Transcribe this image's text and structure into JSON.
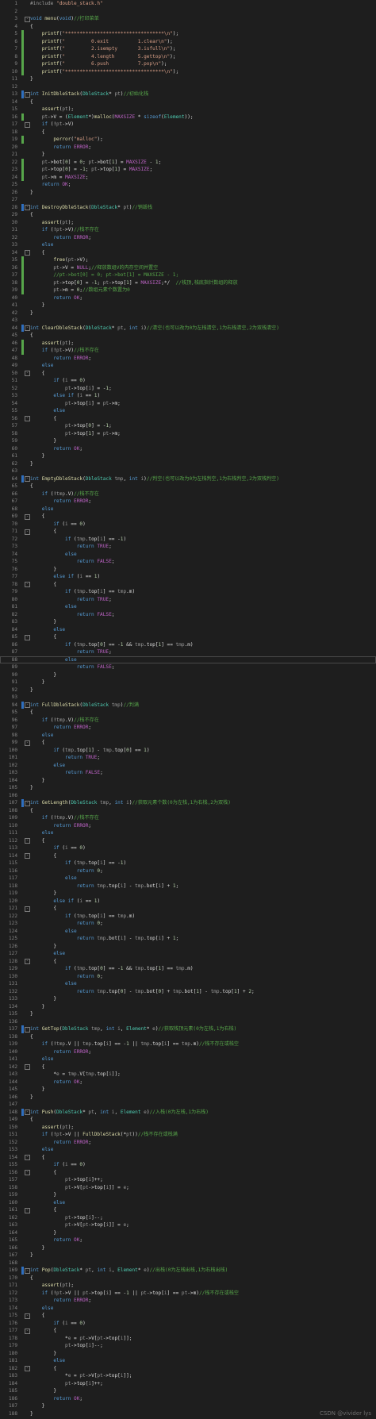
{
  "watermark": "CSDN @vivider lys",
  "colors": {
    "background": "#1e1e1e",
    "keyword": "#569cd6",
    "type": "#4ec9b0",
    "function": "#dcdcaa",
    "string": "#d69d85",
    "comment": "#57a64a",
    "macro": "#bd63c5",
    "number": "#b5cea8",
    "param": "#9a9a9a",
    "text": "#dcdcdc",
    "line_number": "#858585"
  },
  "lines": [
    {
      "n": "1",
      "t": "#include \"double_stack.h\""
    },
    {
      "n": "2",
      "t": ""
    },
    {
      "n": "3",
      "t": "void menu(void)//打印菜单"
    },
    {
      "n": "4",
      "t": "{"
    },
    {
      "n": "5",
      "t": "    printf(\"**********************************\\n\");"
    },
    {
      "n": "6",
      "t": "    printf(\"         0.exit          1.clear\\n\");"
    },
    {
      "n": "7",
      "t": "    printf(\"         2.isempty       3.isfull\\n\");"
    },
    {
      "n": "8",
      "t": "    printf(\"         4.length        5.gettop\\n\");"
    },
    {
      "n": "9",
      "t": "    printf(\"         6.push          7.pop\\n\");"
    },
    {
      "n": "10",
      "t": "    printf(\"**********************************\\n\");"
    },
    {
      "n": "11",
      "t": "}"
    },
    {
      "n": "12",
      "t": ""
    },
    {
      "n": "13",
      "t": "int InitDbleStack(DbleStack* pt)//初始化栈"
    },
    {
      "n": "14",
      "t": "{"
    },
    {
      "n": "15",
      "t": "    assert(pt);"
    },
    {
      "n": "16",
      "t": "    pt->V = (Element*)malloc(MAXSIZE * sizeof(Element));"
    },
    {
      "n": "17",
      "t": "    if (!pt->V)"
    },
    {
      "n": "18",
      "t": "    {"
    },
    {
      "n": "19",
      "t": "        perror(\"malloc\");"
    },
    {
      "n": "20",
      "t": "        return ERROR;"
    },
    {
      "n": "21",
      "t": "    }"
    },
    {
      "n": "22",
      "t": "    pt->bot[0] = 0; pt->bot[1] = MAXSIZE - 1;"
    },
    {
      "n": "23",
      "t": "    pt->top[0] = -1; pt->top[1] = MAXSIZE;"
    },
    {
      "n": "24",
      "t": "    pt->m = MAXSIZE;"
    },
    {
      "n": "25",
      "t": "    return OK;"
    },
    {
      "n": "26",
      "t": "}"
    },
    {
      "n": "27",
      "t": ""
    },
    {
      "n": "28",
      "t": "int DestroyDbleStack(DbleStack* pt)//销毁栈"
    },
    {
      "n": "29",
      "t": "{"
    },
    {
      "n": "30",
      "t": "    assert(pt);"
    },
    {
      "n": "31",
      "t": "    if (!pt->V)//栈不存在"
    },
    {
      "n": "32",
      "t": "        return ERROR;"
    },
    {
      "n": "33",
      "t": "    else"
    },
    {
      "n": "34",
      "t": "    {"
    },
    {
      "n": "35",
      "t": "        free(pt->V);"
    },
    {
      "n": "36",
      "t": "        pt->V = NULL;//释放数组V的内存空间并置空"
    },
    {
      "n": "37",
      "t": "        //pt->bot[0] = 0; pt->bot[1] = MAXSIZE - 1;"
    },
    {
      "n": "38",
      "t": "        pt->top[0] = -1; pt->top[1] = MAXSIZE;*/  //栈顶,栈底指针数组的释放"
    },
    {
      "n": "39",
      "t": "        pt->m = 0;//数组元素个数置为0"
    },
    {
      "n": "40",
      "t": "        return OK;"
    },
    {
      "n": "41",
      "t": "    }"
    },
    {
      "n": "42",
      "t": "}"
    },
    {
      "n": "43",
      "t": ""
    },
    {
      "n": "44",
      "t": "int ClearDbleStack(DbleStack* pt, int i)//清空(也可以改为0为左栈清空,1为右栈清空,2为双栈清空)"
    },
    {
      "n": "45",
      "t": "{"
    },
    {
      "n": "46",
      "t": "    assert(pt);"
    },
    {
      "n": "47",
      "t": "    if (!pt->V)//栈不存在"
    },
    {
      "n": "48",
      "t": "        return ERROR;"
    },
    {
      "n": "49",
      "t": "    else"
    },
    {
      "n": "50",
      "t": "    {"
    },
    {
      "n": "51",
      "t": "        if (i == 0)"
    },
    {
      "n": "52",
      "t": "            pt->top[i] = -1;"
    },
    {
      "n": "53",
      "t": "        else if (i == 1)"
    },
    {
      "n": "54",
      "t": "            pt->top[i] = pt->m;"
    },
    {
      "n": "55",
      "t": "        else"
    },
    {
      "n": "56",
      "t": "        {"
    },
    {
      "n": "57",
      "t": "            pt->top[0] = -1;"
    },
    {
      "n": "58",
      "t": "            pt->top[1] = pt->m;"
    },
    {
      "n": "59",
      "t": "        }"
    },
    {
      "n": "60",
      "t": "        return OK;"
    },
    {
      "n": "61",
      "t": "    }"
    },
    {
      "n": "62",
      "t": "}"
    },
    {
      "n": "63",
      "t": ""
    },
    {
      "n": "64",
      "t": "int EmptyDbleStack(DbleStack tmp, int i)//判空(也可以改为0为左栈判空,1为右栈判空,2为双栈判空)"
    },
    {
      "n": "65",
      "t": "{"
    },
    {
      "n": "66",
      "t": "    if (!tmp.V)//栈不存在"
    },
    {
      "n": "67",
      "t": "        return ERROR;"
    },
    {
      "n": "68",
      "t": "    else"
    },
    {
      "n": "69",
      "t": "    {"
    },
    {
      "n": "70",
      "t": "        if (i == 0)"
    },
    {
      "n": "71",
      "t": "        {"
    },
    {
      "n": "72",
      "t": "            if (tmp.top[i] == -1)"
    },
    {
      "n": "73",
      "t": "                return TRUE;"
    },
    {
      "n": "74",
      "t": "            else"
    },
    {
      "n": "75",
      "t": "                return FALSE;"
    },
    {
      "n": "76",
      "t": "        }"
    },
    {
      "n": "77",
      "t": "        else if (i == 1)"
    },
    {
      "n": "78",
      "t": "        {"
    },
    {
      "n": "79",
      "t": "            if (tmp.top[i] == tmp.m)"
    },
    {
      "n": "80",
      "t": "                return TRUE;"
    },
    {
      "n": "81",
      "t": "            else"
    },
    {
      "n": "82",
      "t": "                return FALSE;"
    },
    {
      "n": "83",
      "t": "        }"
    },
    {
      "n": "84",
      "t": "        else"
    },
    {
      "n": "85",
      "t": "        {"
    },
    {
      "n": "86",
      "t": "            if (tmp.top[0] == -1 && tmp.top[1] == tmp.m)"
    },
    {
      "n": "87",
      "t": "                return TRUE;"
    },
    {
      "n": "88",
      "t": "            else"
    },
    {
      "n": "89",
      "t": "                return FALSE;"
    },
    {
      "n": "90",
      "t": "        }"
    },
    {
      "n": "91",
      "t": "    }"
    },
    {
      "n": "92",
      "t": "}"
    },
    {
      "n": "93",
      "t": ""
    },
    {
      "n": "94",
      "t": "int FullDbleStack(DbleStack tmp)//判满"
    },
    {
      "n": "95",
      "t": "{"
    },
    {
      "n": "96",
      "t": "    if (!tmp.V)//栈不存在"
    },
    {
      "n": "97",
      "t": "        return ERROR;"
    },
    {
      "n": "98",
      "t": "    else"
    },
    {
      "n": "99",
      "t": "    {"
    },
    {
      "n": "100",
      "t": "        if (tmp.top[1] - tmp.top[0] == 1)"
    },
    {
      "n": "101",
      "t": "            return TRUE;"
    },
    {
      "n": "102",
      "t": "        else"
    },
    {
      "n": "103",
      "t": "            return FALSE;"
    },
    {
      "n": "104",
      "t": "    }"
    },
    {
      "n": "105",
      "t": "}"
    },
    {
      "n": "106",
      "t": ""
    },
    {
      "n": "107",
      "t": "int GetLength(DbleStack tmp, int i)//获取元素个数(0为左栈,1为右栈,2为双栈)"
    },
    {
      "n": "108",
      "t": "{"
    },
    {
      "n": "109",
      "t": "    if (!tmp.V)//栈不存在"
    },
    {
      "n": "110",
      "t": "        return ERROR;"
    },
    {
      "n": "111",
      "t": "    else"
    },
    {
      "n": "112",
      "t": "    {"
    },
    {
      "n": "113",
      "t": "        if (i == 0)"
    },
    {
      "n": "114",
      "t": "        {"
    },
    {
      "n": "115",
      "t": "            if (tmp.top[i] == -1)"
    },
    {
      "n": "116",
      "t": "                return 0;"
    },
    {
      "n": "117",
      "t": "            else"
    },
    {
      "n": "118",
      "t": "                return tmp.top[i] - tmp.bot[i] + 1;"
    },
    {
      "n": "119",
      "t": "        }"
    },
    {
      "n": "120",
      "t": "        else if (i == 1)"
    },
    {
      "n": "121",
      "t": "        {"
    },
    {
      "n": "122",
      "t": "            if (tmp.top[i] == tmp.m)"
    },
    {
      "n": "123",
      "t": "                return 0;"
    },
    {
      "n": "124",
      "t": "            else"
    },
    {
      "n": "125",
      "t": "                return tmp.bot[i] - tmp.top[i] + 1;"
    },
    {
      "n": "126",
      "t": "        }"
    },
    {
      "n": "127",
      "t": "        else"
    },
    {
      "n": "128",
      "t": "        {"
    },
    {
      "n": "129",
      "t": "            if (tmp.top[0] == -1 && tmp.top[1] == tmp.m)"
    },
    {
      "n": "130",
      "t": "                return 0;"
    },
    {
      "n": "131",
      "t": "            else"
    },
    {
      "n": "132",
      "t": "                return tmp.top[0] - tmp.bot[0] + tmp.bot[1] - tmp.top[1] + 2;"
    },
    {
      "n": "133",
      "t": "        }"
    },
    {
      "n": "134",
      "t": "    }"
    },
    {
      "n": "135",
      "t": "}"
    },
    {
      "n": "136",
      "t": ""
    },
    {
      "n": "137",
      "t": "int GetTop(DbleStack tmp, int i, Element* e)//获取栈顶元素(0为左栈,1为右栈)"
    },
    {
      "n": "138",
      "t": "{"
    },
    {
      "n": "139",
      "t": "    if (!tmp.V || tmp.top[i] == -1 || tmp.top[i] == tmp.m)//栈不存在或栈空"
    },
    {
      "n": "140",
      "t": "        return ERROR;"
    },
    {
      "n": "141",
      "t": "    else"
    },
    {
      "n": "142",
      "t": "    {"
    },
    {
      "n": "143",
      "t": "        *e = tmp.V[tmp.top[i]];"
    },
    {
      "n": "144",
      "t": "        return OK;"
    },
    {
      "n": "145",
      "t": "    }"
    },
    {
      "n": "146",
      "t": "}"
    },
    {
      "n": "147",
      "t": ""
    },
    {
      "n": "148",
      "t": "int Push(DbleStack* pt, int i, Element e)//入栈(0为左栈,1为右栈)"
    },
    {
      "n": "149",
      "t": "{"
    },
    {
      "n": "150",
      "t": "    assert(pt);"
    },
    {
      "n": "151",
      "t": "    if (!pt->V || FullDbleStack(*pt))//栈不存在或栈满"
    },
    {
      "n": "152",
      "t": "        return ERROR;"
    },
    {
      "n": "153",
      "t": "    else"
    },
    {
      "n": "154",
      "t": "    {"
    },
    {
      "n": "155",
      "t": "        if (i == 0)"
    },
    {
      "n": "156",
      "t": "        {"
    },
    {
      "n": "157",
      "t": "            pt->top[i]++;"
    },
    {
      "n": "158",
      "t": "            pt->V[pt->top[i]] = e;"
    },
    {
      "n": "159",
      "t": "        }"
    },
    {
      "n": "160",
      "t": "        else"
    },
    {
      "n": "161",
      "t": "        {"
    },
    {
      "n": "162",
      "t": "            pt->top[i]--;"
    },
    {
      "n": "163",
      "t": "            pt->V[pt->top[i]] = e;"
    },
    {
      "n": "164",
      "t": "        }"
    },
    {
      "n": "165",
      "t": "        return OK;"
    },
    {
      "n": "166",
      "t": "    }"
    },
    {
      "n": "167",
      "t": "}"
    },
    {
      "n": "168",
      "t": ""
    },
    {
      "n": "169",
      "t": "int Pop(DbleStack* pt, int i, Element* e)//出栈(0为左栈出栈,1为右栈出栈)"
    },
    {
      "n": "170",
      "t": "{"
    },
    {
      "n": "171",
      "t": "    assert(pt);"
    },
    {
      "n": "172",
      "t": "    if (!pt->V || pt->top[i] == -1 || pt->top[i] == pt->m)//栈不存在或栈空"
    },
    {
      "n": "173",
      "t": "        return ERROR;"
    },
    {
      "n": "174",
      "t": "    else"
    },
    {
      "n": "175",
      "t": "    {"
    },
    {
      "n": "176",
      "t": "        if (i == 0)"
    },
    {
      "n": "177",
      "t": "        {"
    },
    {
      "n": "178",
      "t": "            *e = pt->V[pt->top[i]];"
    },
    {
      "n": "179",
      "t": "            pt->top[i]--;"
    },
    {
      "n": "180",
      "t": "        }"
    },
    {
      "n": "181",
      "t": "        else"
    },
    {
      "n": "182",
      "t": "        {"
    },
    {
      "n": "183",
      "t": "            *e = pt->V[pt->top[i]];"
    },
    {
      "n": "184",
      "t": "            pt->top[i]++;"
    },
    {
      "n": "185",
      "t": "        }"
    },
    {
      "n": "186",
      "t": "        return OK;"
    },
    {
      "n": "187",
      "t": "    }"
    },
    {
      "n": "188",
      "t": "}"
    }
  ]
}
